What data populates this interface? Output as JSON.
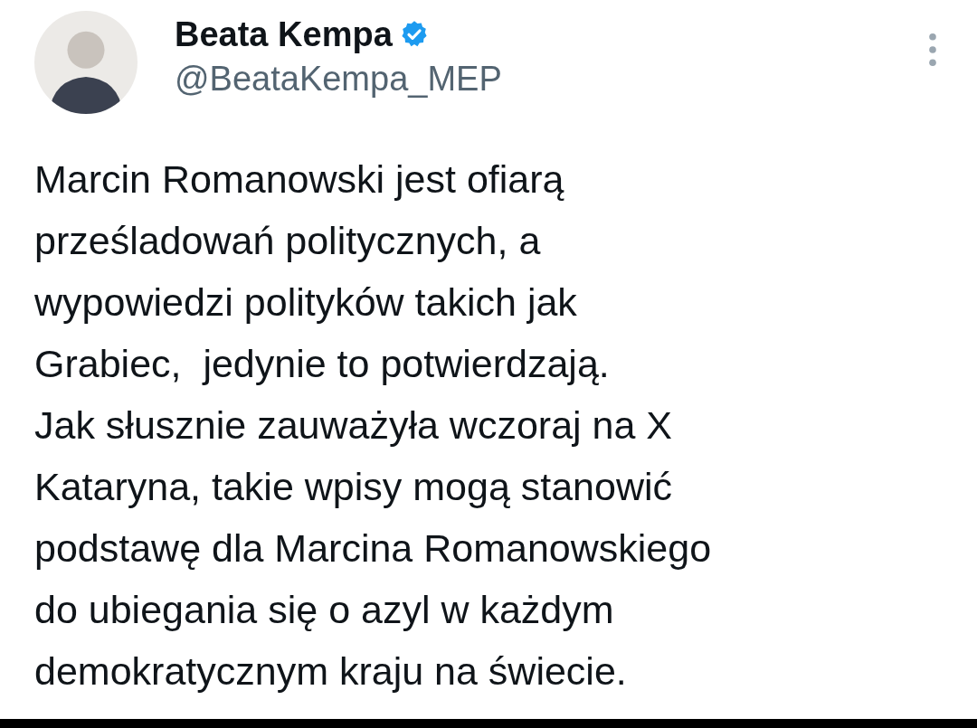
{
  "author": {
    "name": "Beata Kempa",
    "verified": true,
    "handle": "@BeataKempa_MEP"
  },
  "tweet": {
    "text": "Marcin Romanowski jest ofiarą\nprześladowań politycznych, a\nwypowiedzi polityków takich jak\nGrabiec,  jedynie to potwierdzają.\nJak słusznie zauważyła wczoraj na X\nKataryna, takie wpisy mogą stanowić\npodstawę dla Marcina Romanowskiego\ndo ubiegania się o azyl w każdym\ndemokratycznym kraju na świecie."
  }
}
